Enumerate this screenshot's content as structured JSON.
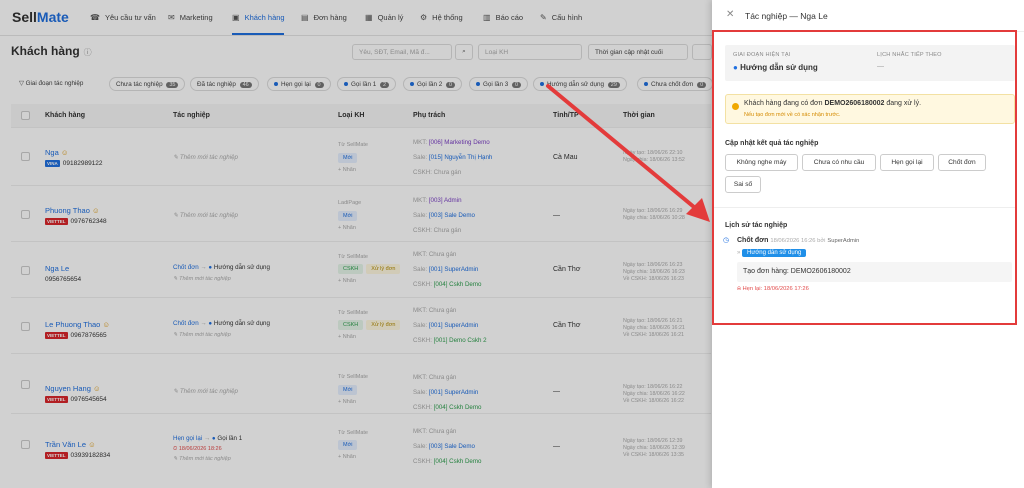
{
  "app": {
    "logo_a": "Sell",
    "logo_b": "Mate"
  },
  "nav": [
    {
      "label": "Yêu cầu tư vấn",
      "icon": "support-icon"
    },
    {
      "label": "Marketing",
      "icon": "marketing-icon"
    },
    {
      "label": "Khách hàng",
      "icon": "customers-icon"
    },
    {
      "label": "Đơn hàng",
      "icon": "orders-icon"
    },
    {
      "label": "Quản lý",
      "icon": "manage-icon"
    },
    {
      "label": "Hệ thống",
      "icon": "system-icon"
    },
    {
      "label": "Báo cáo",
      "icon": "report-icon"
    },
    {
      "label": "Cấu hình",
      "icon": "config-icon"
    }
  ],
  "page": {
    "title": "Khách hàng"
  },
  "filters": {
    "search_placeholder": "Yêu, SĐT, Email, Mã đ...",
    "type_placeholder": "Loại KH",
    "time_label": "Thời gian cập nhật cuối"
  },
  "chips": [
    {
      "label": "Giai đoạn tác nghiệp",
      "count": ""
    },
    {
      "label": "Chưa tác nghiệp",
      "count": "35"
    },
    {
      "label": "Đã tác nghiệp",
      "count": "46"
    },
    {
      "label": "Hẹn gọi lại",
      "count": "0"
    },
    {
      "label": "Gọi lần 1",
      "count": "2"
    },
    {
      "label": "Gọi lần 2",
      "count": "0"
    },
    {
      "label": "Gọi lần 3",
      "count": "0"
    },
    {
      "label": "Hướng dẫn sử dụng",
      "count": "29"
    },
    {
      "label": "Chưa chốt đơn",
      "count": "0"
    }
  ],
  "columns": [
    "Khách hàng",
    "Tác nghiệp",
    "Loại KH",
    "Phụ trách",
    "Tỉnh/TP",
    "Thời gian"
  ],
  "rows": [
    {
      "name": "Nga",
      "carrier": "VINA",
      "phone": "09182989122",
      "action": "Thêm mới tác nghiệp",
      "action_stage": "",
      "src": "Từ SellMate",
      "badges": [
        "Mới"
      ],
      "add": "+ Nhãn",
      "mkt": "MKT:",
      "mkt_v": "[006] Marketing Demo",
      "sale": "Sale:",
      "sale_v": "[015] Nguyễn Thị Hạnh",
      "cskh": "CSKH:",
      "cskh_v": "Chưa gán",
      "city": "Cà Mau",
      "t1": "Ngày tạo: 18/06/26 22:10",
      "t2": "Ngày chia: 18/06/26 13:52",
      "t3": ""
    },
    {
      "name": "Phuong Thao",
      "carrier": "VIETTEL",
      "phone": "0976762348",
      "action": "Thêm mới tác nghiệp",
      "action_stage": "",
      "src": "LadiPage",
      "badges": [
        "Mới"
      ],
      "add": "+ Nhãn",
      "mkt": "MKT:",
      "mkt_v": "[003] Admin",
      "sale": "Sale:",
      "sale_v": "[003] Sale Demo",
      "cskh": "CSKH:",
      "cskh_v": "Chưa gán",
      "city": "—",
      "t1": "Ngày tạo: 18/06/26 16:29",
      "t2": "Ngày chia: 18/06/26 10:28",
      "t3": ""
    },
    {
      "name": "Nga Le",
      "carrier": "",
      "phone": "0956765654",
      "action": "Chốt đơn",
      "action_stage": "Hướng dẫn sử dụng",
      "src": "Từ SellMate",
      "badges": [
        "CSKH",
        "Xử lý đơn"
      ],
      "add": "+ Nhãn",
      "mkt": "MKT:",
      "mkt_v": "Chưa gán",
      "sale": "Sale:",
      "sale_v": "[001] SuperAdmin",
      "cskh": "CSKH:",
      "cskh_v": "[004] Cskh Demo",
      "city": "Cần Thơ",
      "t1": "Ngày tạo: 18/06/26 16:23",
      "t2": "Ngày chia: 18/06/26 16:23",
      "t3": "Về CSKH: 18/06/26 16:23"
    },
    {
      "name": "Le Phuong Thao",
      "carrier": "VIETTEL",
      "phone": "0967876565",
      "action": "Chốt đơn",
      "action_stage": "Hướng dẫn sử dụng",
      "src": "Từ SellMate",
      "badges": [
        "CSKH",
        "Xử lý đơn"
      ],
      "add": "+ Nhãn",
      "mkt": "MKT:",
      "mkt_v": "Chưa gán",
      "sale": "Sale:",
      "sale_v": "[001] SuperAdmin",
      "cskh": "CSKH:",
      "cskh_v": "[001] Demo Cskh 2",
      "city": "Cần Thơ",
      "t1": "Ngày tạo: 18/06/26 16:21",
      "t2": "Ngày chia: 18/06/26 16:21",
      "t3": "Về CSKH: 18/06/26 16:21"
    },
    {
      "name": "Nguyen Hang",
      "carrier": "VIETTEL",
      "phone": "0976545654",
      "action": "Thêm mới tác nghiệp",
      "action_stage": "",
      "src": "Từ SellMate",
      "badges": [
        "Mới"
      ],
      "add": "+ Nhãn",
      "mkt": "MKT:",
      "mkt_v": "Chưa gán",
      "sale": "Sale:",
      "sale_v": "[001] SuperAdmin",
      "cskh": "CSKH:",
      "cskh_v": "[004] Cskh Demo",
      "city": "—",
      "t1": "Ngày tạo: 18/06/26 16:22",
      "t2": "Ngày chia: 18/06/26 16:22",
      "t3": "Về CSKH: 18/06/26 16:22"
    },
    {
      "name": "Trần Văn Le",
      "carrier": "VIETTEL",
      "phone": "03939182834",
      "action": "Hẹn gọi lại",
      "action_stage": "Gọi lần 1",
      "action_date": "18/06/2026 18:26",
      "src": "Từ SellMate",
      "badges": [
        "Mới"
      ],
      "add": "+ Nhãn",
      "mkt": "MKT:",
      "mkt_v": "Chưa gán",
      "sale": "Sale:",
      "sale_v": "[003] Sale Demo",
      "cskh": "CSKH:",
      "cskh_v": "[004] Cskh Demo",
      "city": "—",
      "t1": "Ngày tạo: 18/06/26 12:39",
      "t2": "Ngày chia: 18/06/26 12:39",
      "t3": "Về CSKH: 18/06/26 13:35"
    }
  ],
  "drawer": {
    "title": "Tác nghiệp — Nga Le",
    "stage_label": "GIAI ĐOẠN HIỆN TẠI",
    "stage_value": "Hướng dẫn sử dụng",
    "reminder_label": "LỊCH NHẮC TIẾP THEO",
    "reminder_value": "—",
    "warn_pre": "Khách hàng đang có đơn ",
    "warn_code": "DEMO2606180002",
    "warn_post": " đang xử lý.",
    "warn_sub": "Nếu tạo đơn mới về có xác nhận trước.",
    "result_title": "Cập nhật kết quả tác nghiệp",
    "result_buttons": [
      "Không nghe máy",
      "Chưa có nhu cầu",
      "Hẹn gọi lại",
      "Chốt đơn",
      "Sai số"
    ],
    "history_title": "Lịch sử tác nghiệp",
    "history_action": "Chốt đơn",
    "history_meta": "18/06/2026 16:26 bởi",
    "history_user": "SuperAdmin",
    "history_tag": "Hướng dẫn sử dụng",
    "history_note": "Tạo đơn hàng: DEMO2606180002",
    "history_reminder": "Hẹn lại: 18/06/2026 17:26"
  },
  "colors": {
    "accent": "#1f6fe0",
    "annotation": "#e33b3b"
  }
}
